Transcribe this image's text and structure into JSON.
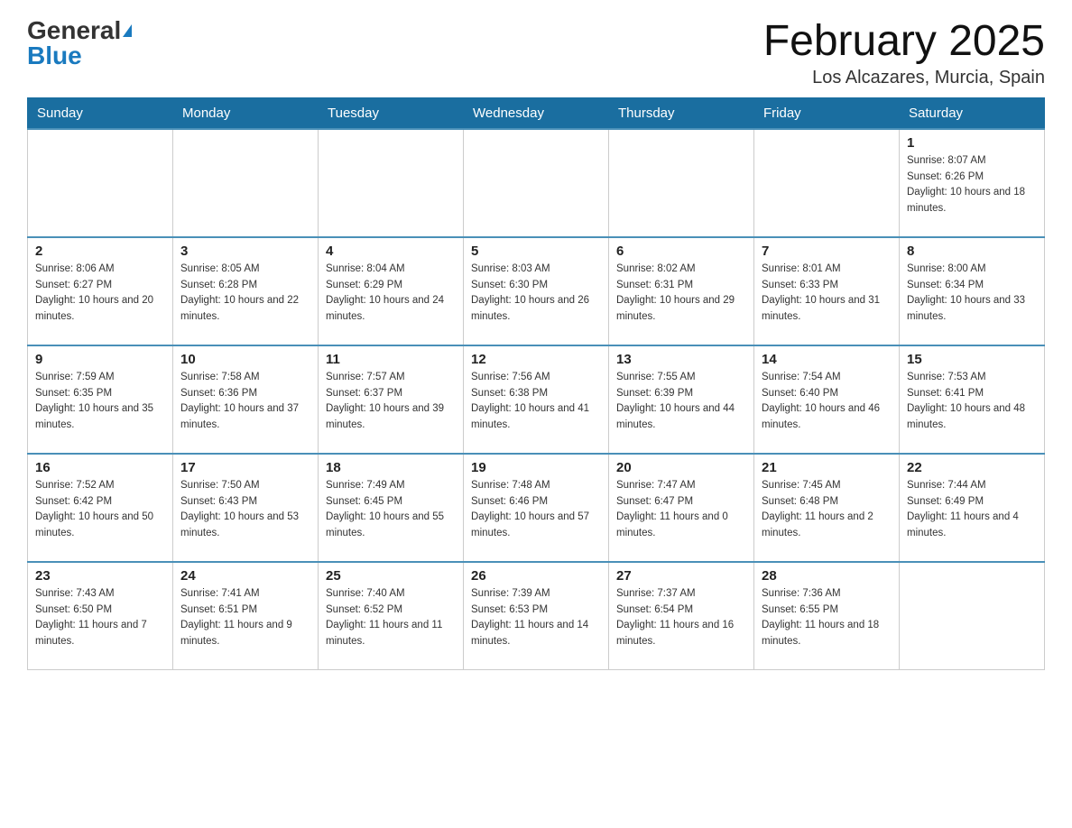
{
  "header": {
    "logo_general": "General",
    "logo_blue": "Blue",
    "month_title": "February 2025",
    "location": "Los Alcazares, Murcia, Spain"
  },
  "days_of_week": [
    "Sunday",
    "Monday",
    "Tuesday",
    "Wednesday",
    "Thursday",
    "Friday",
    "Saturday"
  ],
  "weeks": [
    [
      {
        "day": "",
        "info": ""
      },
      {
        "day": "",
        "info": ""
      },
      {
        "day": "",
        "info": ""
      },
      {
        "day": "",
        "info": ""
      },
      {
        "day": "",
        "info": ""
      },
      {
        "day": "",
        "info": ""
      },
      {
        "day": "1",
        "info": "Sunrise: 8:07 AM\nSunset: 6:26 PM\nDaylight: 10 hours and 18 minutes."
      }
    ],
    [
      {
        "day": "2",
        "info": "Sunrise: 8:06 AM\nSunset: 6:27 PM\nDaylight: 10 hours and 20 minutes."
      },
      {
        "day": "3",
        "info": "Sunrise: 8:05 AM\nSunset: 6:28 PM\nDaylight: 10 hours and 22 minutes."
      },
      {
        "day": "4",
        "info": "Sunrise: 8:04 AM\nSunset: 6:29 PM\nDaylight: 10 hours and 24 minutes."
      },
      {
        "day": "5",
        "info": "Sunrise: 8:03 AM\nSunset: 6:30 PM\nDaylight: 10 hours and 26 minutes."
      },
      {
        "day": "6",
        "info": "Sunrise: 8:02 AM\nSunset: 6:31 PM\nDaylight: 10 hours and 29 minutes."
      },
      {
        "day": "7",
        "info": "Sunrise: 8:01 AM\nSunset: 6:33 PM\nDaylight: 10 hours and 31 minutes."
      },
      {
        "day": "8",
        "info": "Sunrise: 8:00 AM\nSunset: 6:34 PM\nDaylight: 10 hours and 33 minutes."
      }
    ],
    [
      {
        "day": "9",
        "info": "Sunrise: 7:59 AM\nSunset: 6:35 PM\nDaylight: 10 hours and 35 minutes."
      },
      {
        "day": "10",
        "info": "Sunrise: 7:58 AM\nSunset: 6:36 PM\nDaylight: 10 hours and 37 minutes."
      },
      {
        "day": "11",
        "info": "Sunrise: 7:57 AM\nSunset: 6:37 PM\nDaylight: 10 hours and 39 minutes."
      },
      {
        "day": "12",
        "info": "Sunrise: 7:56 AM\nSunset: 6:38 PM\nDaylight: 10 hours and 41 minutes."
      },
      {
        "day": "13",
        "info": "Sunrise: 7:55 AM\nSunset: 6:39 PM\nDaylight: 10 hours and 44 minutes."
      },
      {
        "day": "14",
        "info": "Sunrise: 7:54 AM\nSunset: 6:40 PM\nDaylight: 10 hours and 46 minutes."
      },
      {
        "day": "15",
        "info": "Sunrise: 7:53 AM\nSunset: 6:41 PM\nDaylight: 10 hours and 48 minutes."
      }
    ],
    [
      {
        "day": "16",
        "info": "Sunrise: 7:52 AM\nSunset: 6:42 PM\nDaylight: 10 hours and 50 minutes."
      },
      {
        "day": "17",
        "info": "Sunrise: 7:50 AM\nSunset: 6:43 PM\nDaylight: 10 hours and 53 minutes."
      },
      {
        "day": "18",
        "info": "Sunrise: 7:49 AM\nSunset: 6:45 PM\nDaylight: 10 hours and 55 minutes."
      },
      {
        "day": "19",
        "info": "Sunrise: 7:48 AM\nSunset: 6:46 PM\nDaylight: 10 hours and 57 minutes."
      },
      {
        "day": "20",
        "info": "Sunrise: 7:47 AM\nSunset: 6:47 PM\nDaylight: 11 hours and 0 minutes."
      },
      {
        "day": "21",
        "info": "Sunrise: 7:45 AM\nSunset: 6:48 PM\nDaylight: 11 hours and 2 minutes."
      },
      {
        "day": "22",
        "info": "Sunrise: 7:44 AM\nSunset: 6:49 PM\nDaylight: 11 hours and 4 minutes."
      }
    ],
    [
      {
        "day": "23",
        "info": "Sunrise: 7:43 AM\nSunset: 6:50 PM\nDaylight: 11 hours and 7 minutes."
      },
      {
        "day": "24",
        "info": "Sunrise: 7:41 AM\nSunset: 6:51 PM\nDaylight: 11 hours and 9 minutes."
      },
      {
        "day": "25",
        "info": "Sunrise: 7:40 AM\nSunset: 6:52 PM\nDaylight: 11 hours and 11 minutes."
      },
      {
        "day": "26",
        "info": "Sunrise: 7:39 AM\nSunset: 6:53 PM\nDaylight: 11 hours and 14 minutes."
      },
      {
        "day": "27",
        "info": "Sunrise: 7:37 AM\nSunset: 6:54 PM\nDaylight: 11 hours and 16 minutes."
      },
      {
        "day": "28",
        "info": "Sunrise: 7:36 AM\nSunset: 6:55 PM\nDaylight: 11 hours and 18 minutes."
      },
      {
        "day": "",
        "info": ""
      }
    ]
  ]
}
